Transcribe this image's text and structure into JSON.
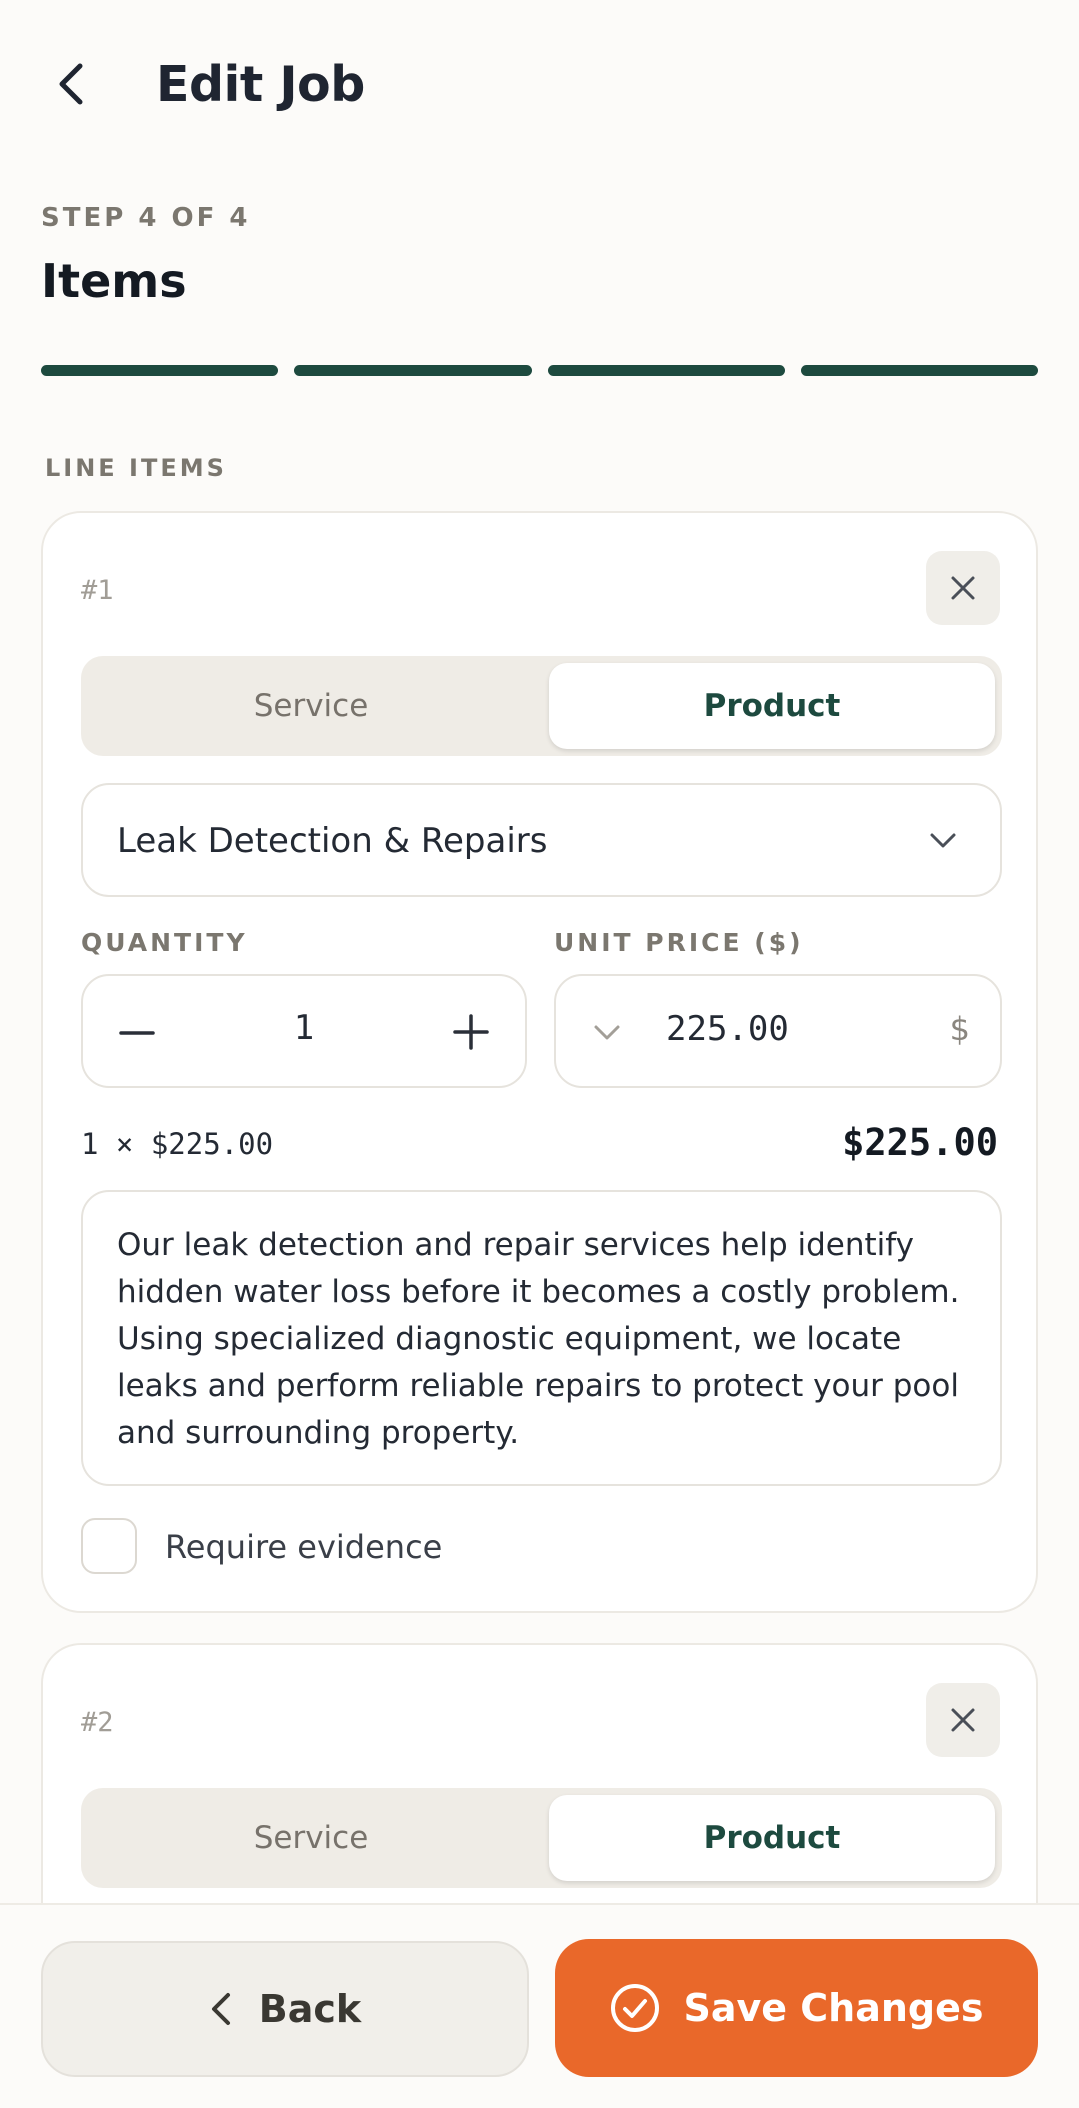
{
  "header": {
    "title": "Edit Job"
  },
  "step": {
    "label": "STEP 4 OF 4",
    "title": "Items",
    "total_steps": 4,
    "completed_steps": 4
  },
  "section": {
    "label": "LINE ITEMS"
  },
  "items": [
    {
      "number": "#1",
      "type_options": [
        "Service",
        "Product"
      ],
      "selected_type": "Product",
      "product_name": "Leak Detection & Repairs",
      "quantity_label": "QUANTITY",
      "quantity": "1",
      "price_label": "UNIT PRICE ($)",
      "unit_price": "225.00",
      "currency_symbol": "$",
      "calc_line": "1 × $225.00",
      "line_total": "$225.00",
      "description": "Our leak detection and repair services help identify hidden water loss before it becomes a costly problem. Using specialized diagnostic equipment, we locate leaks and perform reliable repairs to protect your pool and surrounding property.",
      "require_evidence_label": "Require evidence",
      "require_evidence": false
    },
    {
      "number": "#2",
      "type_options": [
        "Service",
        "Product"
      ],
      "selected_type": "Product"
    }
  ],
  "footer": {
    "back_label": "Back",
    "save_label": "Save Changes"
  },
  "colors": {
    "accent": "#e9682a",
    "progress": "#1d4a3f",
    "selected_text": "#1d4a3f"
  }
}
